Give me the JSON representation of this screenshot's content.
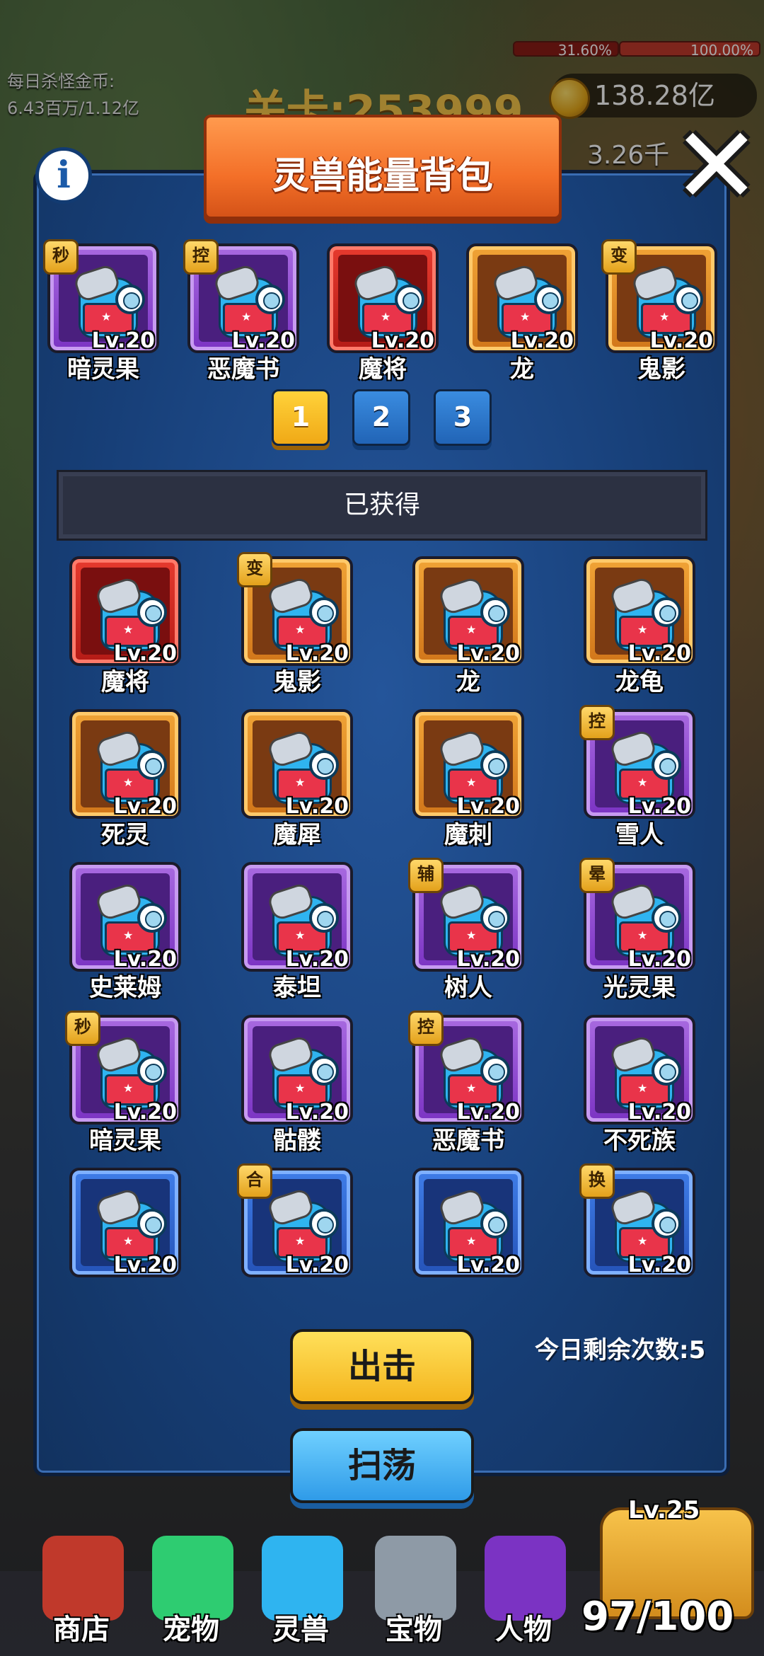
{
  "hud": {
    "daily_gold_label": "每日杀怪金币:",
    "daily_gold_value": "6.43百万/1.12亿",
    "stage": "关卡:253999",
    "progress_left": "31.60%",
    "progress_right": "100.00%",
    "coins": "138.28亿",
    "dps": "3.26千"
  },
  "dialog": {
    "title": "灵兽能量背包",
    "info_label": "i",
    "close_label": "✕"
  },
  "equipped": [
    {
      "name": "暗灵果",
      "level": "Lv.20",
      "rarity": "purple",
      "badge": "秒"
    },
    {
      "name": "恶魔书",
      "level": "Lv.20",
      "rarity": "purple",
      "badge": "控"
    },
    {
      "name": "魔将",
      "level": "Lv.20",
      "rarity": "red",
      "badge": ""
    },
    {
      "name": "龙",
      "level": "Lv.20",
      "rarity": "orange",
      "badge": ""
    },
    {
      "name": "鬼影",
      "level": "Lv.20",
      "rarity": "orange",
      "badge": "变"
    }
  ],
  "pages": [
    "1",
    "2",
    "3"
  ],
  "active_page": "1",
  "obtained_label": "已获得",
  "obtained": [
    {
      "name": "魔将",
      "level": "Lv.20",
      "rarity": "red",
      "badge": ""
    },
    {
      "name": "鬼影",
      "level": "Lv.20",
      "rarity": "orange",
      "badge": "变"
    },
    {
      "name": "龙",
      "level": "Lv.20",
      "rarity": "orange",
      "badge": ""
    },
    {
      "name": "龙龟",
      "level": "Lv.20",
      "rarity": "orange",
      "badge": ""
    },
    {
      "name": "死灵",
      "level": "Lv.20",
      "rarity": "orange",
      "badge": ""
    },
    {
      "name": "魔犀",
      "level": "Lv.20",
      "rarity": "orange",
      "badge": ""
    },
    {
      "name": "魔刺",
      "level": "Lv.20",
      "rarity": "orange",
      "badge": ""
    },
    {
      "name": "雪人",
      "level": "Lv.20",
      "rarity": "purple",
      "badge": "控"
    },
    {
      "name": "史莱姆",
      "level": "Lv.20",
      "rarity": "purple",
      "badge": ""
    },
    {
      "name": "泰坦",
      "level": "Lv.20",
      "rarity": "purple",
      "badge": ""
    },
    {
      "name": "树人",
      "level": "Lv.20",
      "rarity": "purple",
      "badge": "辅"
    },
    {
      "name": "光灵果",
      "level": "Lv.20",
      "rarity": "purple",
      "badge": "晕"
    },
    {
      "name": "暗灵果",
      "level": "Lv.20",
      "rarity": "purple",
      "badge": "秒"
    },
    {
      "name": "骷髅",
      "level": "Lv.20",
      "rarity": "purple",
      "badge": ""
    },
    {
      "name": "恶魔书",
      "level": "Lv.20",
      "rarity": "purple",
      "badge": "控"
    },
    {
      "name": "不死族",
      "level": "Lv.20",
      "rarity": "purple",
      "badge": ""
    },
    {
      "name": "",
      "level": "Lv.20",
      "rarity": "blue",
      "badge": ""
    },
    {
      "name": "",
      "level": "Lv.20",
      "rarity": "blue",
      "badge": "合"
    },
    {
      "name": "",
      "level": "Lv.20",
      "rarity": "blue",
      "badge": ""
    },
    {
      "name": "",
      "level": "Lv.20",
      "rarity": "blue",
      "badge": "换"
    }
  ],
  "remaining_today": "今日剩余次数:5",
  "attack_label": "出击",
  "sweep_label": "扫荡",
  "nav": [
    {
      "label": "商店",
      "icon": "shop-icon",
      "color": "#c0392b"
    },
    {
      "label": "宠物",
      "icon": "pet-icon",
      "color": "#2ecc71"
    },
    {
      "label": "灵兽",
      "icon": "spirit-beast-icon",
      "color": "#2fb4f0"
    },
    {
      "label": "宝物",
      "icon": "treasure-icon",
      "color": "#8e9aa6"
    },
    {
      "label": "人物",
      "icon": "character-book-icon",
      "color": "#7b33c3"
    }
  ],
  "chest": {
    "level": "Lv.25",
    "count": "97/100"
  },
  "colors": {
    "panel": "#1b4a8c",
    "banner": "#f36f28",
    "attack_button": "#f4b51e",
    "sweep_button": "#2f9be8"
  }
}
